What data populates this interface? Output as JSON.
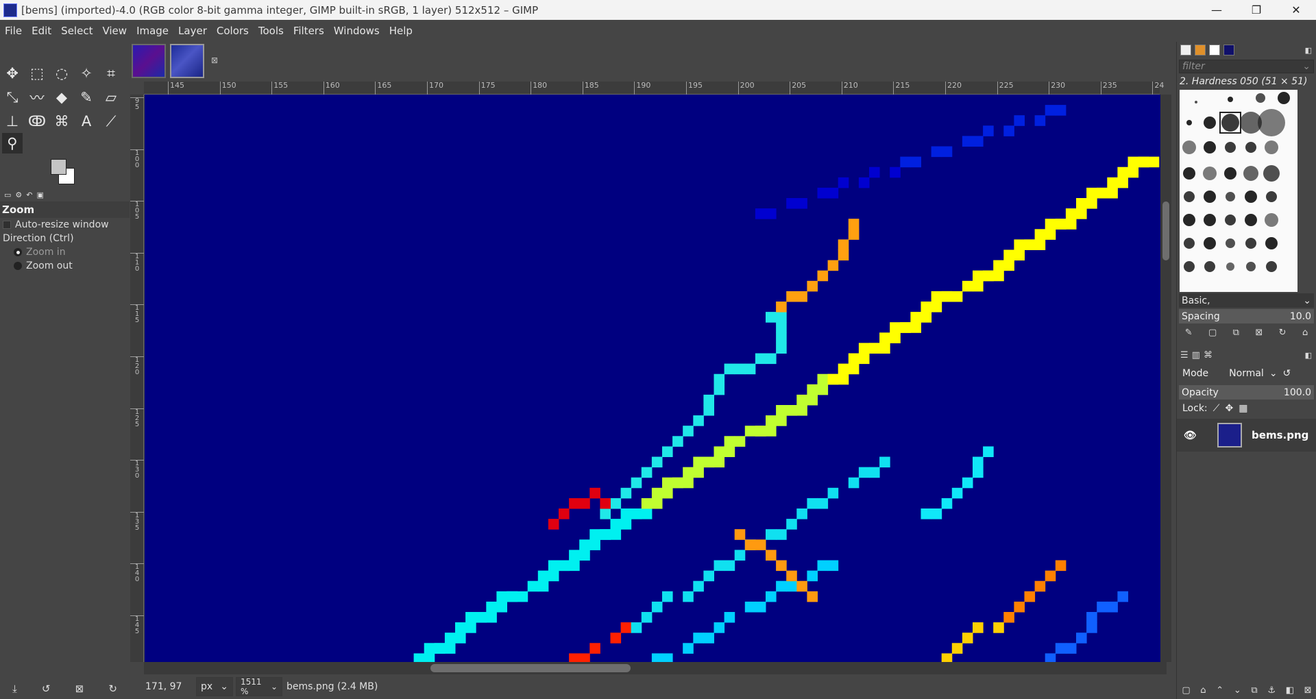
{
  "window": {
    "title": "[bems] (imported)-4.0 (RGB color 8-bit gamma integer, GIMP built-in sRGB, 1 layer) 512x512 – GIMP",
    "minimize": "—",
    "maximize": "❐",
    "close": "✕"
  },
  "menu": [
    "File",
    "Edit",
    "Select",
    "View",
    "Image",
    "Layer",
    "Colors",
    "Tools",
    "Filters",
    "Windows",
    "Help"
  ],
  "tool_options": {
    "title": "Zoom",
    "auto_resize": "Auto-resize window",
    "direction_label": "Direction  (Ctrl)",
    "zoom_in": "Zoom in",
    "zoom_out": "Zoom out"
  },
  "ruler_top": [
    "145",
    "150",
    "155",
    "160",
    "165",
    "170",
    "175",
    "180",
    "185",
    "190",
    "195",
    "200",
    "205",
    "210",
    "215",
    "220",
    "225",
    "230",
    "235",
    "24"
  ],
  "ruler_left": [
    "95",
    "100",
    "105",
    "110",
    "115",
    "120",
    "125",
    "130",
    "135",
    "140",
    "145"
  ],
  "status": {
    "coords": "171, 97",
    "unit": "px",
    "zoom": "1511 %",
    "file_info": "bems.png (2.4 MB)"
  },
  "brushes": {
    "filter_placeholder": "filter",
    "selected_brush": "2. Hardness 050 (51 × 51)",
    "preset": "Basic,",
    "spacing_label": "Spacing",
    "spacing_value": "10.0"
  },
  "layers": {
    "mode_label": "Mode",
    "mode_value": "Normal",
    "opacity_label": "Opacity",
    "opacity_value": "100.0",
    "lock_label": "Lock:",
    "layer_name": "bems.png"
  },
  "colors": {
    "canvas_bg": "#000080"
  }
}
